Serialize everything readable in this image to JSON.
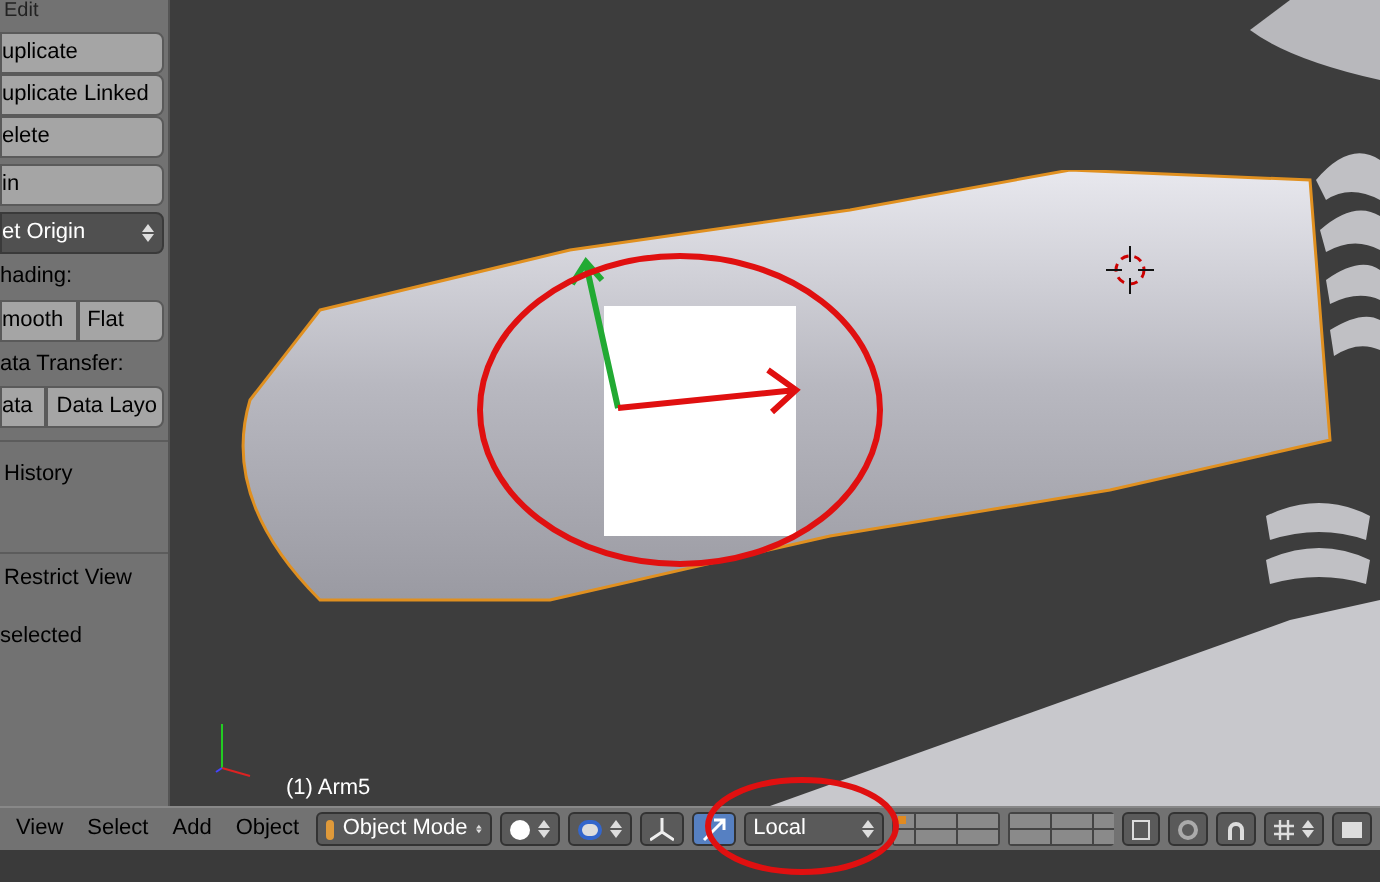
{
  "tool_panel": {
    "header": "Edit",
    "groups": [
      {
        "kind": "stack",
        "items": [
          "uplicate",
          "uplicate Linked",
          "elete"
        ]
      },
      {
        "kind": "stack",
        "items": [
          "in"
        ]
      },
      {
        "kind": "dropdown",
        "items": [
          "et Origin"
        ]
      },
      {
        "kind": "label",
        "items": [
          "hading:"
        ]
      },
      {
        "kind": "row",
        "items": [
          "mooth",
          "Flat"
        ]
      },
      {
        "kind": "label",
        "items": [
          "ata Transfer:"
        ]
      },
      {
        "kind": "row",
        "items": [
          "ata",
          "Data Layo"
        ]
      }
    ]
  },
  "history_panel": {
    "header": "History"
  },
  "restrict_panel": {
    "header": "Restrict View",
    "text": "selected"
  },
  "viewport": {
    "object_label": "(1) Arm5"
  },
  "header": {
    "menus": [
      "View",
      "Select",
      "Add",
      "Object"
    ],
    "mode": "Object Mode",
    "orientation": "Local"
  }
}
